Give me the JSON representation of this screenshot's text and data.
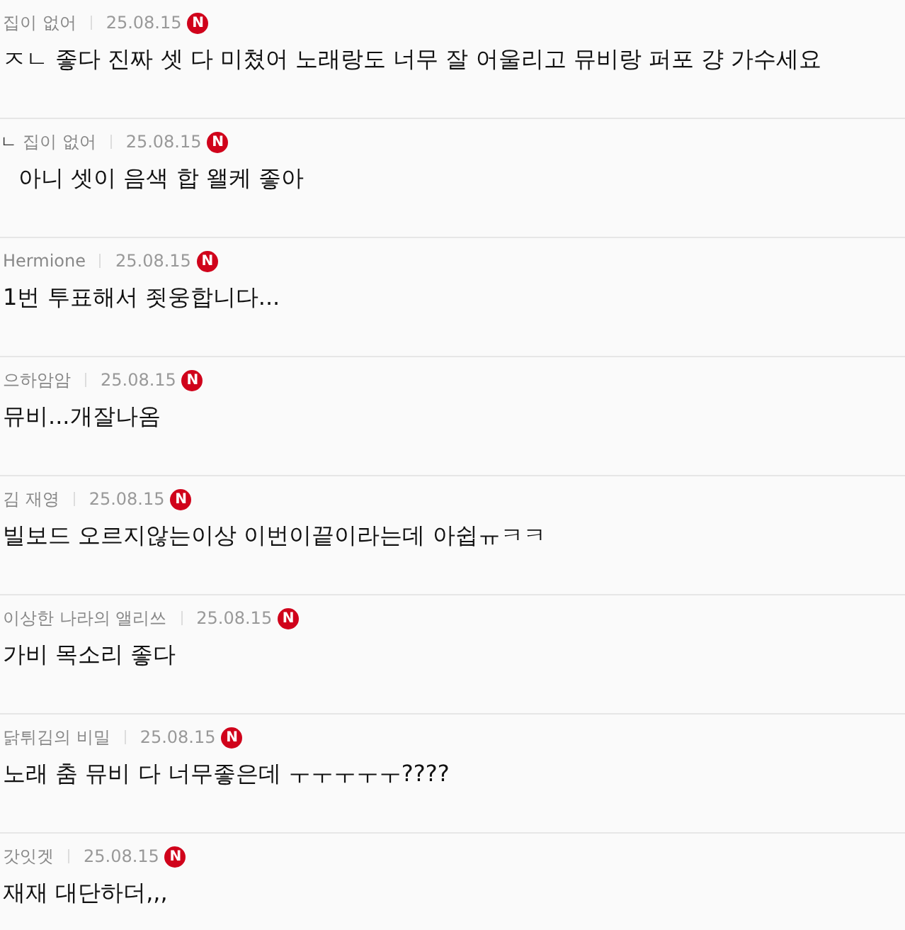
{
  "comments": [
    {
      "kind": "comment",
      "author": "집이 없어",
      "date": "25.08.15",
      "badge": "N",
      "text": "ㅈㄴ 좋다 진짜 셋 다 미쳤어 노래랑도 너무 잘 어울리고 뮤비랑 퍼포 걍 가수세요"
    },
    {
      "kind": "reply",
      "reply_mark": "ㄴ",
      "author": "집이 없어",
      "date": "25.08.15",
      "badge": "N",
      "text": "아니 셋이 음색 합 왤케 좋아"
    },
    {
      "kind": "comment",
      "author": "Hermione",
      "date": "25.08.15",
      "badge": "N",
      "text": "1번 투표해서 죗웅합니다..."
    },
    {
      "kind": "comment",
      "author": "으하암암",
      "date": "25.08.15",
      "badge": "N",
      "text": "뮤비...개잘나옴"
    },
    {
      "kind": "comment",
      "author": "김 재영",
      "date": "25.08.15",
      "badge": "N",
      "text": "빌보드 오르지않는이상 이번이끝이라는데 아쉽ㅠㅋㅋ"
    },
    {
      "kind": "comment",
      "author": "이상한 나라의 앨리쓰",
      "date": "25.08.15",
      "badge": "N",
      "text": "가비 목소리 좋다"
    },
    {
      "kind": "comment",
      "author": "닭튀김의 비밀",
      "date": "25.08.15",
      "badge": "N",
      "text": "노래 춤 뮤비 다 너무좋은데 ㅜㅜㅜㅜㅜ????"
    },
    {
      "kind": "comment",
      "author": "갓잇겟",
      "date": "25.08.15",
      "badge": "N",
      "text": "재재 대단하더,,,"
    }
  ]
}
